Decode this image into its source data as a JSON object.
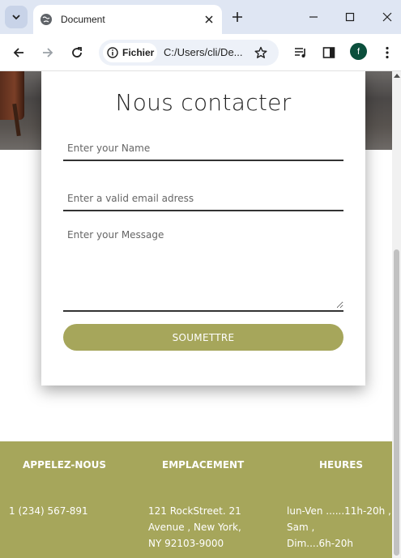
{
  "browser": {
    "tab_title": "Document",
    "site_chip_label": "Fichier",
    "url": "C:/Users/cli/De...",
    "profile_initial": "f"
  },
  "form": {
    "title": "Nous contacter",
    "name_placeholder": "Enter your Name",
    "email_placeholder": "Enter a valid email adress",
    "message_placeholder": "Enter your Message",
    "submit_label": "SOUMETTRE"
  },
  "footer": {
    "columns": [
      {
        "heading": "APPELEZ-NOUS",
        "lines": [
          "1 (234) 567-891"
        ]
      },
      {
        "heading": "EMPLACEMENT",
        "lines": [
          "121 RockStreet. 21",
          "Avenue , New York,",
          "NY 92103-9000"
        ]
      },
      {
        "heading": "HEURES",
        "lines": [
          "lun-Ven ......11h-20h ,",
          "Sam ,",
          "Dim....6h-20h"
        ]
      }
    ]
  },
  "colors": {
    "accent": "#a6a65b",
    "chrome_tabbar": "#dfe6f3"
  }
}
